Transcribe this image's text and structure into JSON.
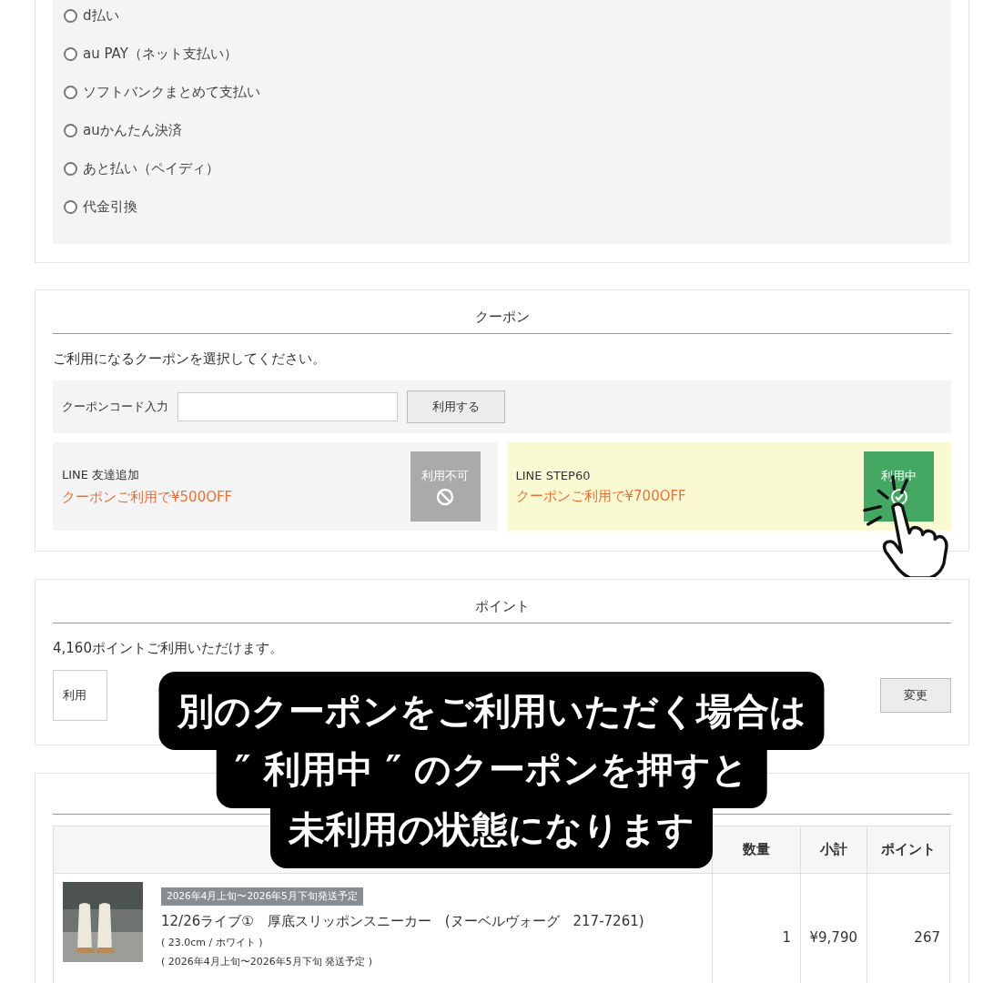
{
  "payment_methods": [
    {
      "label": "d払い",
      "selected": false
    },
    {
      "label": "au PAY（ネット支払い）",
      "selected": false
    },
    {
      "label": "ソフトバンクまとめて支払い",
      "selected": false
    },
    {
      "label": "auかんたん決済",
      "selected": false
    },
    {
      "label": "あと払い（ペイディ）",
      "selected": false
    },
    {
      "label": "代金引換",
      "selected": false
    }
  ],
  "coupon": {
    "title": "クーポン",
    "instruction": "ご利用になるクーポンを選択してください。",
    "code_label": "クーポンコード入力",
    "apply_button": "利用する",
    "items": [
      {
        "name": "LINE 友達追加",
        "offer": "クーポンご利用で¥500OFF",
        "button": "利用不可",
        "kind": "unavailable",
        "selected": false
      },
      {
        "name": "LINE STEP60",
        "offer": "クーポンご利用で¥700OFF",
        "button": "利用中",
        "kind": "in_use",
        "selected": true
      }
    ]
  },
  "points": {
    "title": "ポイント",
    "available": "4,160ポイントご利用いただけます。",
    "field_label": "利用",
    "change_button": "変更"
  },
  "order": {
    "columns": [
      "数量",
      "小計",
      "ポイント"
    ],
    "rows": [
      {
        "badge": "2026年4月上旬〜2026年5月下旬発送予定",
        "name": "12/26ライブ①　厚底スリッポンスニーカー　(ヌーベルヴォーグ　217-7261)",
        "options": "( 23.0cm / ホワイト )",
        "shipping": "( 2026年4月上旬〜2026年5月下旬 発送予定 )",
        "quantity": "1",
        "subtotal": "¥9,790",
        "points": "267"
      }
    ]
  },
  "caption": {
    "lines": [
      "別のクーポンをご利用いただく場合は",
      "″ 利用中 ″ のクーポンを押すと",
      "未利用の状態になります"
    ]
  }
}
